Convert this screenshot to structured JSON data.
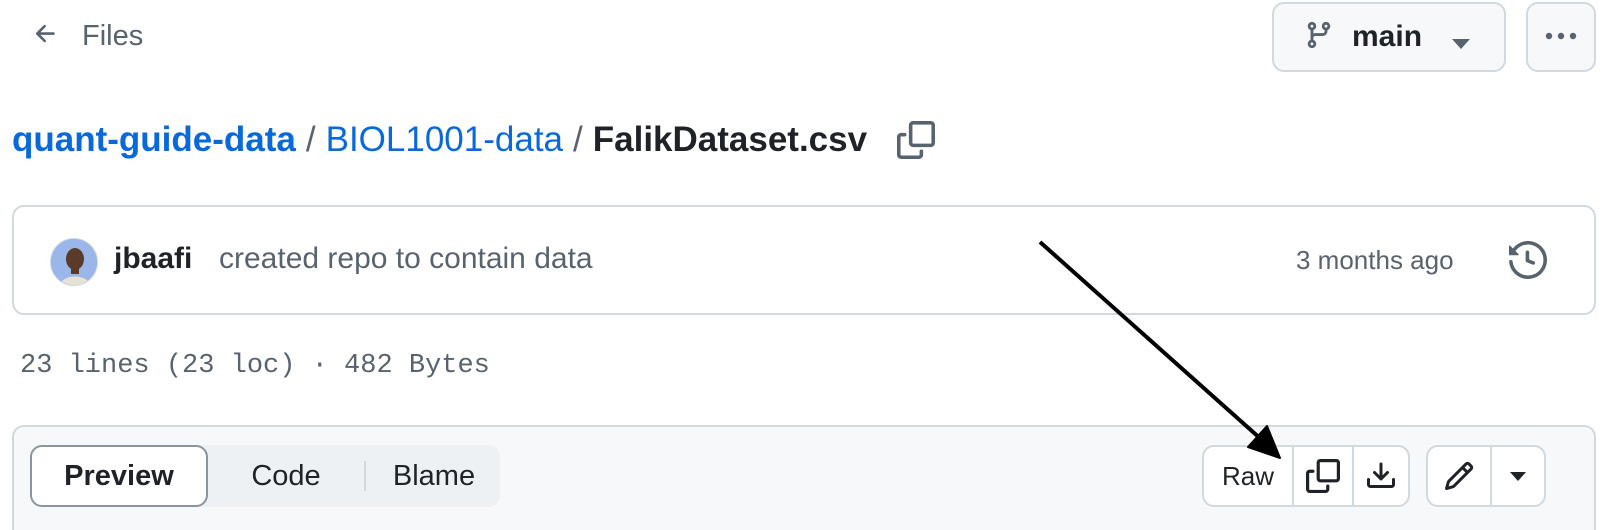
{
  "header": {
    "back_label": "Files",
    "branch": "main"
  },
  "breadcrumb": {
    "repo": "quant-guide-data",
    "folder": "BIOL1001-data",
    "file": "FalikDataset.csv",
    "separator": "/"
  },
  "commit": {
    "author": "jbaafi",
    "message": "created repo to contain data",
    "time": "3 months ago"
  },
  "file_info": "23 lines (23 loc) · 482 Bytes",
  "view_tabs": [
    "Preview",
    "Code",
    "Blame"
  ],
  "active_tab": "Preview",
  "actions": {
    "raw_label": "Raw"
  },
  "icons": {
    "back": "arrow-left-icon",
    "branch": "git-branch-icon",
    "more": "kebab-horizontal-icon",
    "copy_path": "copy-icon",
    "history": "history-icon",
    "copy_raw": "copy-icon",
    "download": "download-icon",
    "edit": "pencil-icon",
    "edit_menu": "triangle-down-icon"
  },
  "colors": {
    "link": "#0969da",
    "muted": "#59636e",
    "border": "#d1d9e0",
    "annotation_arrow": "#000000"
  }
}
